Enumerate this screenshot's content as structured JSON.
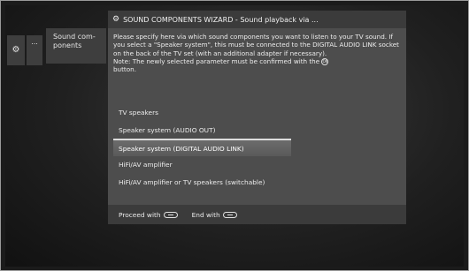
{
  "sidebar": {
    "gear_icon": "gear-icon",
    "dots_label": "...",
    "sound_label": "Sound com-ponents"
  },
  "wizard": {
    "title": "SOUND COMPONENTS WIZARD - Sound playback via ...",
    "description": "Please specify here via which sound components you want to listen to your TV sound. If you select a \"Speaker system\", this must be connected to the DIGITAL AUDIO LINK socket on the back of the TV set (with an additional adapter if necessary).",
    "note_prefix": "Note: The newly selected parameter must be confirmed with the",
    "note_suffix": "button.",
    "ok_icon": "ok-button-icon",
    "options": [
      "TV speakers",
      "Speaker system (AUDIO OUT)",
      "Speaker system (DIGITAL AUDIO LINK)",
      "HiFi/AV amplifier",
      "HiFi/AV amplifier or TV speakers (switchable)"
    ],
    "selected_index": 2,
    "footer": {
      "proceed_label": "Proceed with",
      "end_label": "End with"
    }
  }
}
